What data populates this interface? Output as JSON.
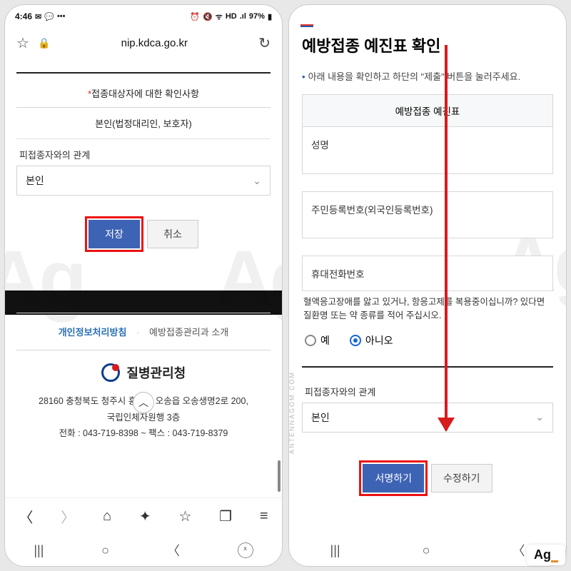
{
  "statusbar": {
    "time": "4:46",
    "notif_icons": [
      "mail-icon",
      "chat-icon",
      "more-icon"
    ],
    "right_icons": [
      "alarm-icon",
      "vibrate-icon",
      "wifi-icon",
      "hd-icon",
      "signal-icon"
    ],
    "battery": "97%"
  },
  "browser": {
    "url": "nip.kdca.go.kr",
    "nav_icons": [
      "back",
      "forward",
      "home",
      "sparkle",
      "bookmark",
      "tabs",
      "menu"
    ]
  },
  "left": {
    "section_required_prefix": "*",
    "section_title": "접종대상자에 대한 확인사항",
    "principal": "본인(법정대리인, 보호자)",
    "relation_label": "피접종자와의 관계",
    "relation_value": "본인",
    "save": "저장",
    "cancel": "취소",
    "footer_link1": "개인정보처리방침",
    "footer_link2": "예방접종관리과 소개",
    "agency_name": "질병관리청",
    "address_line1": "28160 충청북도 청주시 흥덕구 오송읍 오송생명2로 200,",
    "address_line2": "국립인체자원행 3층",
    "contact": "전화 : 043-719-8398 ~        팩스 : 043-719-8379"
  },
  "right": {
    "title": "예방접종 예진표 확인",
    "instruction": "아래 내용을 확인하고 하단의 \"제출\" 버튼을 눌러주세요.",
    "table_head": "예방접종 예진표",
    "name_label": "성명",
    "rrn_label": "주민등록번호(외국인등록번호)",
    "phone_label": "휴대전화번호",
    "question": "혈액응고장애를 앓고 있거나, 항응고제를 복용중이십니까? 있다면 질환명 또는 약 종류를 적어 주십시오.",
    "yes": "예",
    "no": "아니오",
    "relation_label": "피접종자와의 관계",
    "relation_value": "본인",
    "sign": "서명하기",
    "edit": "수정하기"
  },
  "watermark": "Ag",
  "sidetext": "ANTENNAGOM.COM",
  "badge": "Ag"
}
